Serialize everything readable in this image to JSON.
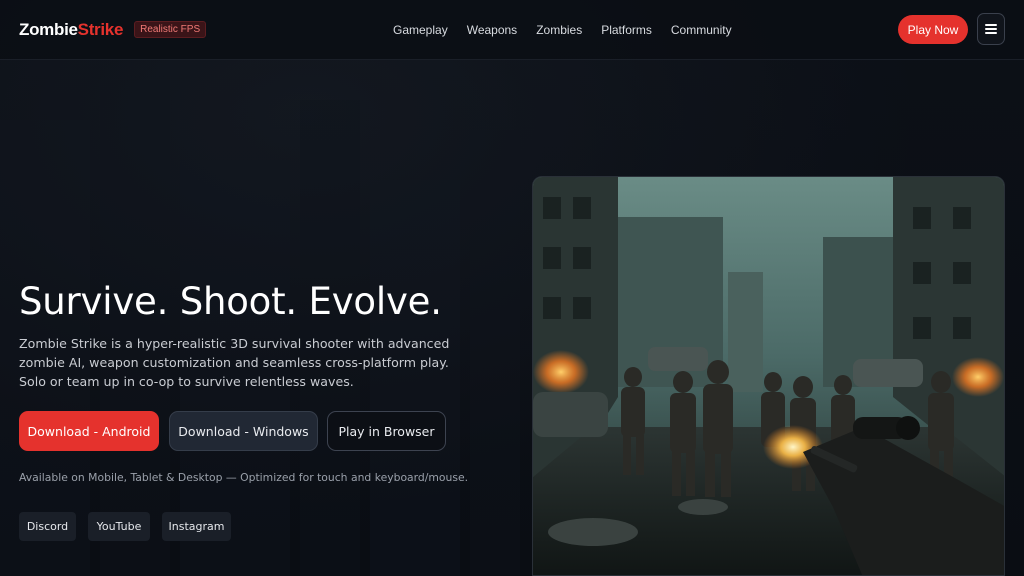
{
  "header": {
    "logo_main": "Zombie",
    "logo_accent": "Strike",
    "badge": "Realistic FPS",
    "nav": [
      "Gameplay",
      "Weapons",
      "Zombies",
      "Platforms",
      "Community"
    ],
    "cta": "Play Now",
    "menu_icon": "hamburger-menu-icon"
  },
  "hero": {
    "title": "Survive. Shoot. Evolve.",
    "description": "Zombie Strike is a hyper-realistic 3D survival shooter with advanced zombie AI, weapon customization and seamless cross-platform play. Solo or team up in co-op to survive relentless waves.",
    "buttons": {
      "android": "Download - Android",
      "windows": "Download - Windows",
      "browser": "Play in Browser"
    },
    "availability": "Available on Mobile, Tablet & Desktop — Optimized for touch and keyboard/mouse.",
    "social": [
      "Discord",
      "YouTube",
      "Instagram"
    ]
  },
  "colors": {
    "accent": "#e5322d",
    "background": "#0b0e14"
  }
}
